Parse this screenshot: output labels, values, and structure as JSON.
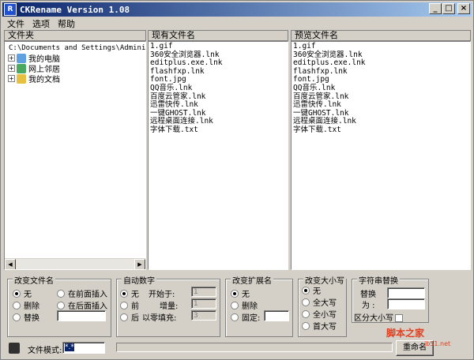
{
  "window": {
    "title": "CKRename Version 1.08",
    "min": "_",
    "max": "□",
    "close": "×"
  },
  "menu": [
    "文件",
    "选项",
    "帮助"
  ],
  "folders": {
    "header": "文件夹",
    "items": [
      {
        "label": "C:\\Documents and Settings\\Admini"
      },
      {
        "label": "我的电脑"
      },
      {
        "label": "网上邻居"
      },
      {
        "label": "我的文档"
      }
    ]
  },
  "current": {
    "header": "现有文件名",
    "files": [
      "1.gif",
      "360安全浏览器.lnk",
      "editplus.exe.lnk",
      "flashfxp.lnk",
      "font.jpg",
      "QQ音乐.lnk",
      "百度云管家.lnk",
      "迅雷快传.lnk",
      "一键GHOST.lnk",
      "远程桌面连接.lnk",
      "字体下载.txt"
    ]
  },
  "preview": {
    "header": "预览文件名",
    "files": [
      "1.gif",
      "360安全浏览器.lnk",
      "editplus.exe.lnk",
      "flashfxp.lnk",
      "font.jpg",
      "QQ音乐.lnk",
      "百度云管家.lnk",
      "迅雷快传.lnk",
      "一键GHOST.lnk",
      "远程桌面连接.lnk",
      "字体下载.txt"
    ]
  },
  "change_name": {
    "title": "改变文件名",
    "none": "无",
    "delete": "删除",
    "replace": "替换",
    "insert_front": "在前面插入",
    "insert_back": "在后面插入"
  },
  "auto_number": {
    "title": "自动数字",
    "none": "无",
    "front": "前",
    "back": "后",
    "start": "开始于:",
    "increment": "增量:",
    "zero_fill": "以零填充:",
    "start_val": "1",
    "inc_val": "1",
    "zero_val": "3"
  },
  "change_ext": {
    "title": "改变扩展名",
    "none": "无",
    "delete": "删除",
    "fixed": "固定:"
  },
  "change_case": {
    "title": "改变大小写",
    "none": "无",
    "upper": "全大写",
    "lower": "全小写",
    "capital": "首大写"
  },
  "string_replace": {
    "title": "字符串替换",
    "replace": "替换",
    "with": "为 :",
    "case": "区分大小写"
  },
  "bottom": {
    "pattern_label": "文件模式:",
    "pattern_value": "*.*",
    "rename_button": "重命名"
  },
  "watermark": {
    "text": "脚本之家",
    "sub": "jb51.net"
  }
}
